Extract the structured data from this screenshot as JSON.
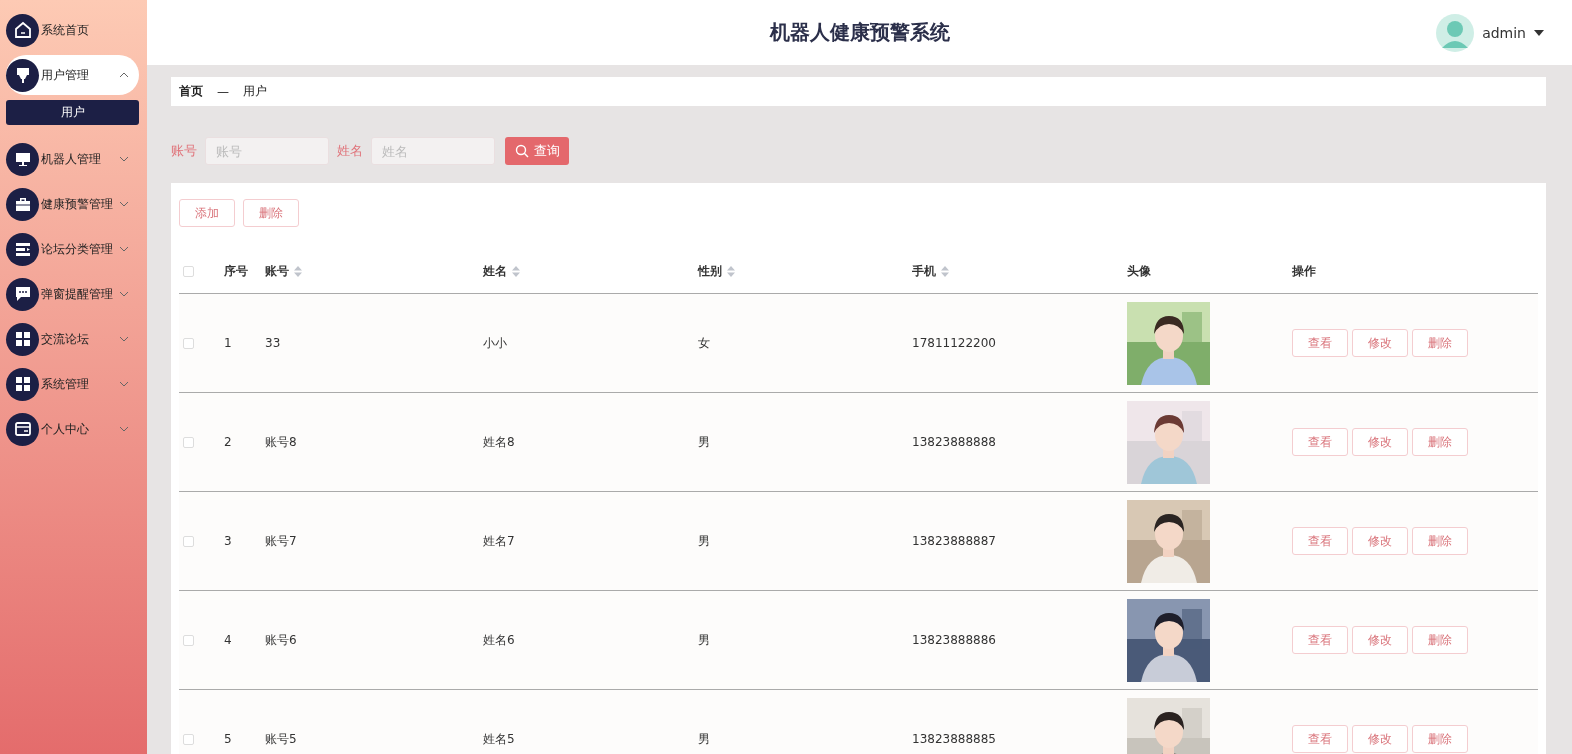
{
  "header": {
    "title": "机器人健康预警系统",
    "user": "admin"
  },
  "sidebar": {
    "items": [
      {
        "label": "系统首页",
        "selected": false
      },
      {
        "label": "用户管理",
        "selected": true,
        "expanded": true,
        "children": [
          {
            "label": "用户",
            "selected": true
          }
        ]
      },
      {
        "label": "机器人管理",
        "selected": false,
        "expanded": false
      },
      {
        "label": "健康预警管理",
        "selected": false,
        "expanded": false
      },
      {
        "label": "论坛分类管理",
        "selected": false,
        "expanded": false
      },
      {
        "label": "弹窗提醒管理",
        "selected": false,
        "expanded": false
      },
      {
        "label": "交流论坛",
        "selected": false,
        "expanded": false
      },
      {
        "label": "系统管理",
        "selected": false,
        "expanded": false
      },
      {
        "label": "个人中心",
        "selected": false,
        "expanded": false
      }
    ]
  },
  "breadcrumb": [
    "首页",
    "—",
    "用户"
  ],
  "search": {
    "fields": [
      {
        "label": "账号",
        "placeholder": "账号"
      },
      {
        "label": "姓名",
        "placeholder": "姓名"
      }
    ],
    "button": "查询"
  },
  "toolbar": [
    "添加",
    "删除"
  ],
  "table": {
    "columns": [
      {
        "label": "序号",
        "sortable": false
      },
      {
        "label": "账号",
        "sortable": true
      },
      {
        "label": "姓名",
        "sortable": true
      },
      {
        "label": "性别",
        "sortable": true
      },
      {
        "label": "手机",
        "sortable": true
      },
      {
        "label": "头像",
        "sortable": false
      },
      {
        "label": "操作",
        "sortable": false
      }
    ],
    "all_checked": false,
    "rows": [
      {
        "index": "1",
        "account": "33",
        "name": "小小",
        "gender": "女",
        "phone": "17811122200",
        "checked": false,
        "actions": [
          "查看",
          "修改",
          "删除"
        ]
      },
      {
        "index": "2",
        "account": "账号8",
        "name": "姓名8",
        "gender": "男",
        "phone": "13823888888",
        "checked": false,
        "actions": [
          "查看",
          "修改",
          "删除"
        ]
      },
      {
        "index": "3",
        "account": "账号7",
        "name": "姓名7",
        "gender": "男",
        "phone": "13823888887",
        "checked": false,
        "actions": [
          "查看",
          "修改",
          "删除"
        ]
      },
      {
        "index": "4",
        "account": "账号6",
        "name": "姓名6",
        "gender": "男",
        "phone": "13823888886",
        "checked": false,
        "actions": [
          "查看",
          "修改",
          "删除"
        ]
      },
      {
        "index": "5",
        "account": "账号5",
        "name": "姓名5",
        "gender": "男",
        "phone": "13823888885",
        "checked": false,
        "actions": [
          "查看",
          "修改",
          "删除"
        ]
      }
    ]
  }
}
